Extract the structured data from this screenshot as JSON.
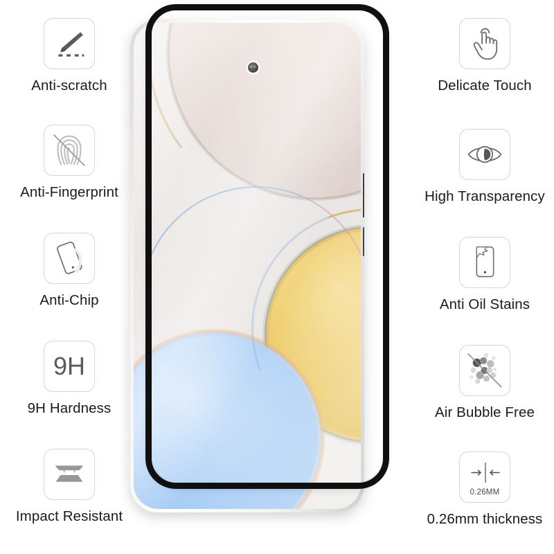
{
  "page": {
    "title": "Tempered Glass Screen Protector Feature Infographic",
    "background_color": "#ffffff",
    "text_color": "#1b1b1b",
    "icon_border_color": "#d6d6d6",
    "icon_glyph_color": "#5a5a5a"
  },
  "features_left": [
    {
      "label": "Anti-scratch",
      "icon": "knife-scratch-icon"
    },
    {
      "label": "Anti-Fingerprint",
      "icon": "fingerprint-blocked-icon"
    },
    {
      "label": "Anti-Chip",
      "icon": "tilted-phone-icon"
    },
    {
      "label": "9H Hardness",
      "icon": "nine-h-icon",
      "glyph_text": "9H"
    },
    {
      "label": "Impact Resistant",
      "icon": "stacked-layers-icon"
    }
  ],
  "features_right": [
    {
      "label": "Delicate Touch",
      "icon": "tapping-hand-icon"
    },
    {
      "label": "High Transparency",
      "icon": "eye-icon"
    },
    {
      "label": "Anti Oil Stains",
      "icon": "phone-stain-icon"
    },
    {
      "label": "Air Bubble Free",
      "icon": "bubbles-blocked-icon"
    },
    {
      "label": "0.26mm thickness",
      "icon": "thickness-arrows-icon",
      "glyph_text": "0.26MM"
    }
  ],
  "product": {
    "name": "phone-with-tempered-glass-protector",
    "glass_edge_color": "#111111",
    "watermark_text": "",
    "wallpaper": {
      "description": "overlapping iridescent circles",
      "circle_colors": [
        "#e3d6d2",
        "#edc75c",
        "#a9cef6"
      ]
    }
  }
}
